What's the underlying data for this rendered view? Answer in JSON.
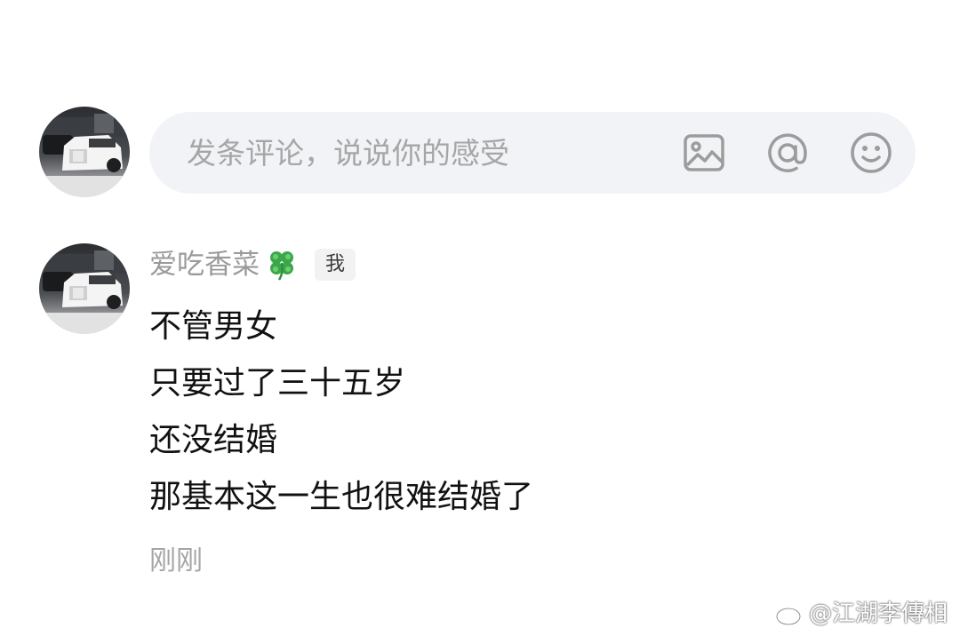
{
  "composer": {
    "placeholder": "发条评论，说说你的感受",
    "icons": [
      "image-icon",
      "at-icon",
      "emoji-icon"
    ],
    "background_color": "#f1f3f6"
  },
  "comment": {
    "username": "爱吃香菜",
    "username_icon": "four-leaf-clover-icon",
    "badge": "我",
    "lines": [
      "不管男女",
      "只要过了三十五岁",
      "还没结婚",
      "那基本这一生也很难结婚了"
    ],
    "time": "刚刚"
  },
  "watermark": {
    "text": "@江湖李傳相",
    "logo": "weibo-logo"
  }
}
